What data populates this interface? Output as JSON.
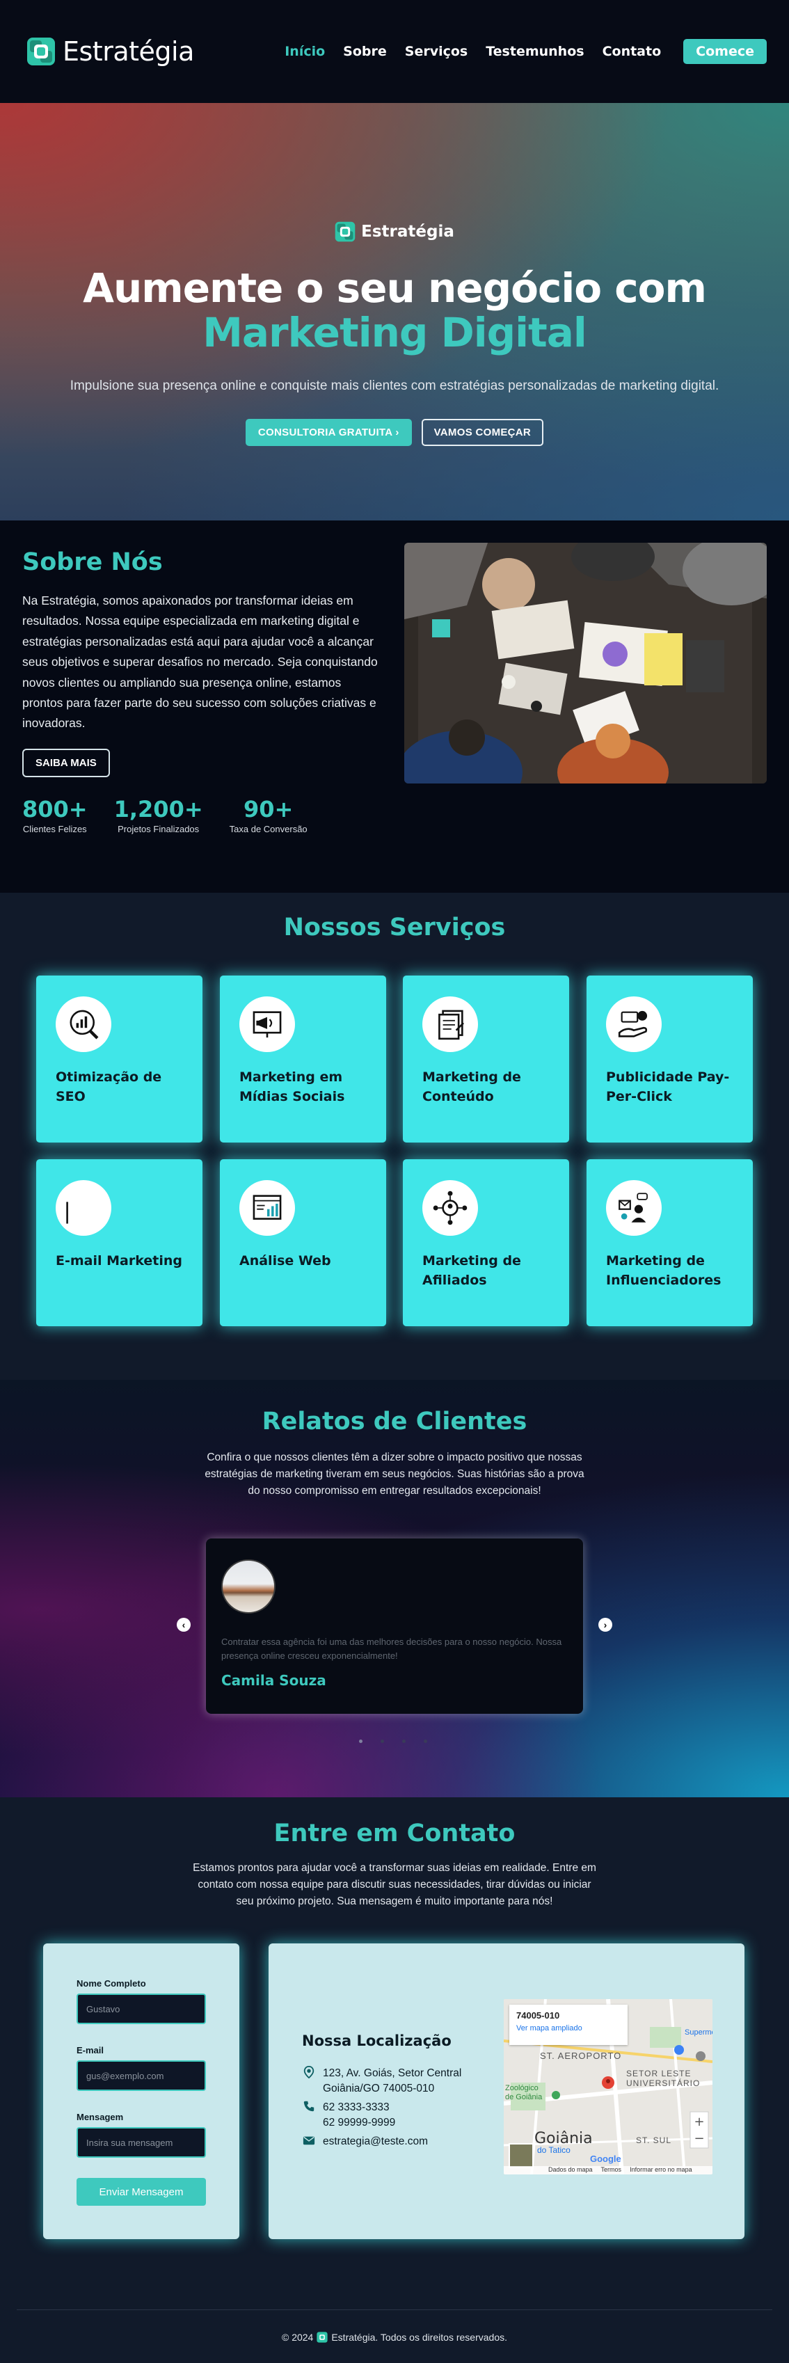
{
  "header": {
    "brand": "Estratégia",
    "nav": [
      "Início",
      "Sobre",
      "Serviços",
      "Testemunhos",
      "Contato"
    ],
    "cta": "Comece"
  },
  "hero": {
    "brand": "Estratégia",
    "title_line1": "Aumente o seu negócio com",
    "title_line2": "Marketing Digital",
    "subtitle": "Impulsione sua presença online e conquiste mais clientes com estratégias personalizadas de marketing digital.",
    "btn_primary": "CONSULTORIA GRATUITA",
    "btn_secondary": "VAMOS COMEÇAR"
  },
  "about": {
    "title": "Sobre Nós",
    "text": "Na Estratégia, somos apaixonados por transformar ideias em resultados. Nossa equipe especializada em marketing digital e estratégias personalizadas está aqui para ajudar você a alcançar seus objetivos e superar desafios no mercado. Seja conquistando novos clientes ou ampliando sua presença online, estamos prontos para fazer parte do seu sucesso com soluções criativas e inovadoras.",
    "button": "SAIBA MAIS",
    "stats": [
      {
        "value": "800+",
        "label": "Clientes Felizes"
      },
      {
        "value": "1,200+",
        "label": "Projetos Finalizados"
      },
      {
        "value": "90+",
        "label": "Taxa de Conversão"
      }
    ]
  },
  "services": {
    "title": "Nossos Serviços",
    "items": [
      {
        "name": "Otimização de SEO",
        "icon": "seo-chart-icon"
      },
      {
        "name": "Marketing em Mídias Sociais",
        "icon": "megaphone-icon"
      },
      {
        "name": "Marketing de Conteúdo",
        "icon": "content-pages-icon"
      },
      {
        "name": "Publicidade Pay-Per-Click",
        "icon": "pay-per-click-icon"
      },
      {
        "name": "E-mail Marketing",
        "icon": "email-icon"
      },
      {
        "name": "Análise Web",
        "icon": "web-analytics-icon"
      },
      {
        "name": "Marketing de Afiliados",
        "icon": "affiliate-network-icon"
      },
      {
        "name": "Marketing de Influenciadores",
        "icon": "influencer-icon"
      }
    ]
  },
  "testimonials": {
    "title": "Relatos de Clientes",
    "intro": "Confira o que nossos clientes têm a dizer sobre o impacto positivo que nossas estratégias de marketing tiveram em seus negócios. Suas histórias são a prova do nosso compromisso em entregar resultados excepcionais!",
    "quote": "Contratar essa agência foi uma das melhores decisões para o nosso negócio. Nossa presença online cresceu exponencialmente!",
    "name": "Camila Souza",
    "prev": "‹",
    "next": "›"
  },
  "contact": {
    "title": "Entre em Contato",
    "intro": "Estamos prontos para ajudar você a transformar suas ideias em realidade. Entre em contato com nossa equipe para discutir suas necessidades, tirar dúvidas ou iniciar seu próximo projeto. Sua mensagem é muito importante para nós!",
    "form": {
      "name_label": "Nome Completo",
      "name_placeholder": "Gustavo",
      "email_label": "E-mail",
      "email_placeholder": "gus@exemplo.com",
      "message_label": "Mensagem",
      "message_placeholder": "Insira sua mensagem",
      "submit": "Enviar Mensagem"
    },
    "location": {
      "title": "Nossa Localização",
      "address_line1": "123, Av. Goiás, Setor Central",
      "address_line2": "Goiânia/GO 74005-010",
      "phone1": "62 3333-3333",
      "phone2": "62 99999-9999",
      "email": "estrategia@teste.com"
    },
    "map": {
      "cep": "74005-010",
      "link": "Ver mapa ampliado",
      "label_aeroporto": "ST. AEROPORTO",
      "label_setor_leste": "SETOR LESTE UNIVERSITÁRIO",
      "label_city": "Goiânia",
      "label_st_sul": "ST. SUL",
      "label_zoo": "Zoológico de Goiânia",
      "label_super": "Supermerca",
      "label_tatico": "do Tatico",
      "footer": [
        "Dados do mapa",
        "Termos",
        "Informar erro no mapa"
      ],
      "google": "Google"
    }
  },
  "footer": {
    "copyright_pre": "© 2024",
    "brand": "Estratégia",
    "copyright_post": ". Todos os direitos reservados."
  },
  "colors": {
    "accent": "#3ec9be",
    "card": "#40e6e8",
    "header_bg": "#070b16"
  }
}
